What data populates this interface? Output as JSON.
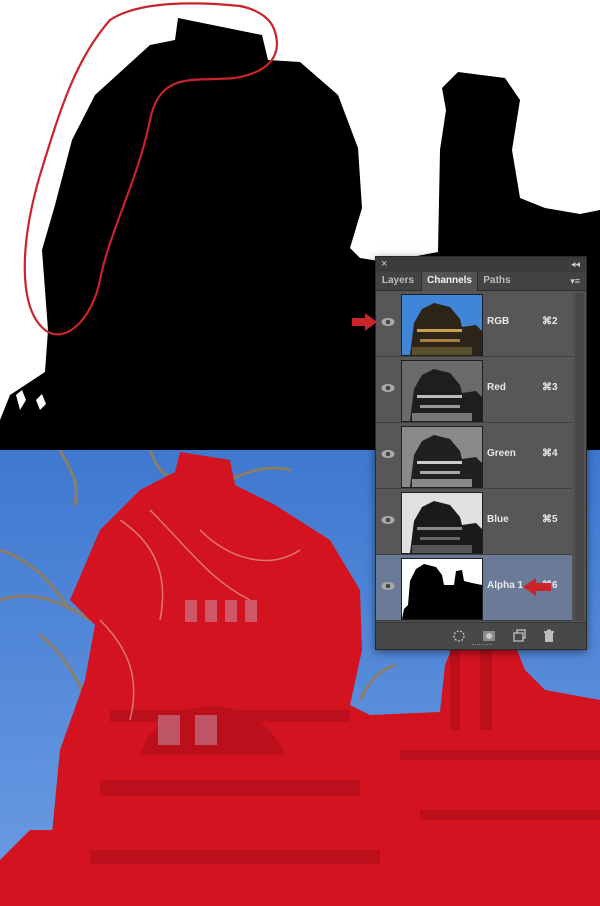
{
  "panel": {
    "close_glyph": "×",
    "collapse_glyph": "◂◂",
    "menu_glyph": "▾≡",
    "tabs": [
      {
        "label": "Layers",
        "active": false
      },
      {
        "label": "Channels",
        "active": true
      },
      {
        "label": "Paths",
        "active": false
      }
    ],
    "channels": [
      {
        "name": "RGB",
        "shortcut": "⌘2",
        "visible": true,
        "thumb": "color",
        "selected": false
      },
      {
        "name": "Red",
        "shortcut": "⌘3",
        "visible": true,
        "thumb": "gray",
        "selected": false
      },
      {
        "name": "Green",
        "shortcut": "⌘4",
        "visible": true,
        "thumb": "gray",
        "selected": false
      },
      {
        "name": "Blue",
        "shortcut": "⌘5",
        "visible": true,
        "thumb": "gray",
        "selected": false
      },
      {
        "name": "Alpha 1",
        "shortcut": "⌘6",
        "visible": true,
        "thumb": "mask",
        "selected": true
      }
    ],
    "footer_icons": [
      "load-selection-icon",
      "save-selection-icon",
      "new-channel-icon",
      "trash-icon"
    ]
  },
  "annotations": {
    "circle_color": "#c8242a",
    "arrow_color": "#c8242a"
  },
  "colors": {
    "overlay_red": "#d3131f",
    "sky": "#4f86d8",
    "selected_row": "#6b7b97"
  }
}
